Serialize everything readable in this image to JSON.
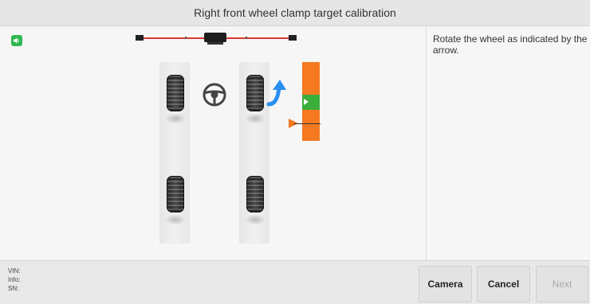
{
  "header": {
    "title": "Right front wheel clamp target calibration"
  },
  "instruction": {
    "text": "Rotate the wheel as indicated by the arrow."
  },
  "status": {
    "vin_label": "VIN:",
    "info_label": "Info:",
    "sn_label": "SN:"
  },
  "buttons": {
    "camera": "Camera",
    "cancel": "Cancel",
    "next": "Next"
  },
  "icons": {
    "speaker": "speaker-icon",
    "steering": "steering-wheel-icon",
    "rotate_arrow": "rotate-arrow-icon"
  },
  "colors": {
    "accent_orange": "#f47920",
    "status_green": "#3aae3a",
    "rotate_arrow_blue": "#2a8ff0",
    "sensor_line_red": "#d9382f"
  }
}
